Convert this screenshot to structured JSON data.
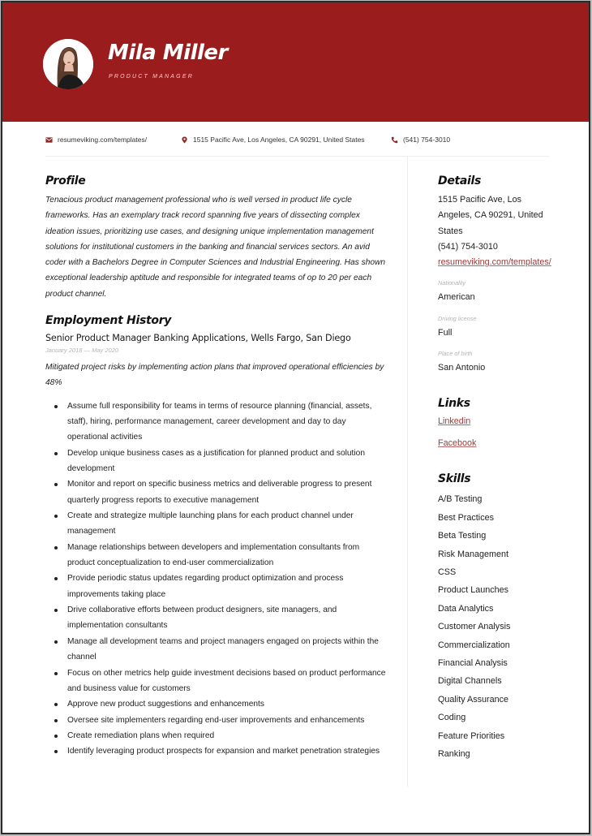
{
  "header": {
    "name": "Mila Miller",
    "title": "Product Manager",
    "accent_color": "#9b1c1c"
  },
  "contact": {
    "website": "resumeviking.com/templates/",
    "address": "1515 Pacific Ave, Los Angeles, CA 90291, United States",
    "phone": "(541) 754-3010",
    "icons": [
      "envelope-icon",
      "map-pin-icon",
      "phone-icon"
    ]
  },
  "profile": {
    "heading": "Profile",
    "text": "Tenacious product management professional who is well versed in product life cycle frameworks. Has an exemplary track record spanning five years of dissecting complex ideation issues, prioritizing use cases, and designing unique implementation management solutions for institutional customers in the banking and financial services sectors. An avid coder with a Bachelors Degree in Computer Sciences and Industrial Engineering. Has shown exceptional leadership aptitude and responsible for integrated teams of op to 20 per each product channel."
  },
  "employment": {
    "heading": "Employment History",
    "jobs": [
      {
        "title": "Senior Product Manager Banking Applications, Wells Fargo, San Diego",
        "dates": "January 2018 — May 2020",
        "summary": "Mitigated project risks by implementing action plans that improved operational efficiencies by 48%",
        "bullets": [
          "Assume full responsibility for teams in terms of resource planning (financial, assets, staff), hiring, performance management, career development and day to day operational activities",
          "Develop unique business cases as a justification for planned product and solution development",
          "Monitor and report on specific business metrics and deliverable progress to present quarterly progress reports to executive management",
          "Create and strategize multiple launching plans for each product channel under management",
          "Manage relationships between developers and implementation consultants from product conceptualization to end-user commercialization",
          "Provide periodic status updates regarding product optimization and process improvements taking place",
          "Drive collaborative efforts between product designers, site managers, and implementation consultants",
          "Manage all development teams and project managers engaged on projects within the channel",
          "Focus on other metrics help guide investment decisions based on product performance and business value for customers",
          "Approve new product suggestions and enhancements",
          "Oversee site implementers regarding end-user improvements and enhancements",
          "Create remediation plans when required",
          "Identify leveraging product prospects for expansion and market penetration strategies"
        ]
      }
    ]
  },
  "details": {
    "heading": "Details",
    "address": "1515 Pacific Ave, Los Angeles, CA 90291, United States",
    "phone": "(541) 754-3010",
    "website": "resumeviking.com/templates/",
    "nationality_label": "Nationality",
    "nationality": "American",
    "license_label": "Driving license",
    "license": "Full",
    "birthplace_label": "Place of birth",
    "birthplace": "San Antonio"
  },
  "links": {
    "heading": "Links",
    "items": [
      "Linkedin",
      "Facebook"
    ]
  },
  "skills": {
    "heading": "Skills",
    "items": [
      "A/B Testing",
      "Best Practices",
      "Beta Testing",
      "Risk Management",
      "CSS",
      "Product Launches",
      "Data Analytics",
      "Customer Analysis",
      "Commercialization",
      "Financial Analysis",
      "Digital Channels",
      "Quality Assurance",
      "Coding",
      "Feature Priorities",
      "Ranking"
    ]
  }
}
